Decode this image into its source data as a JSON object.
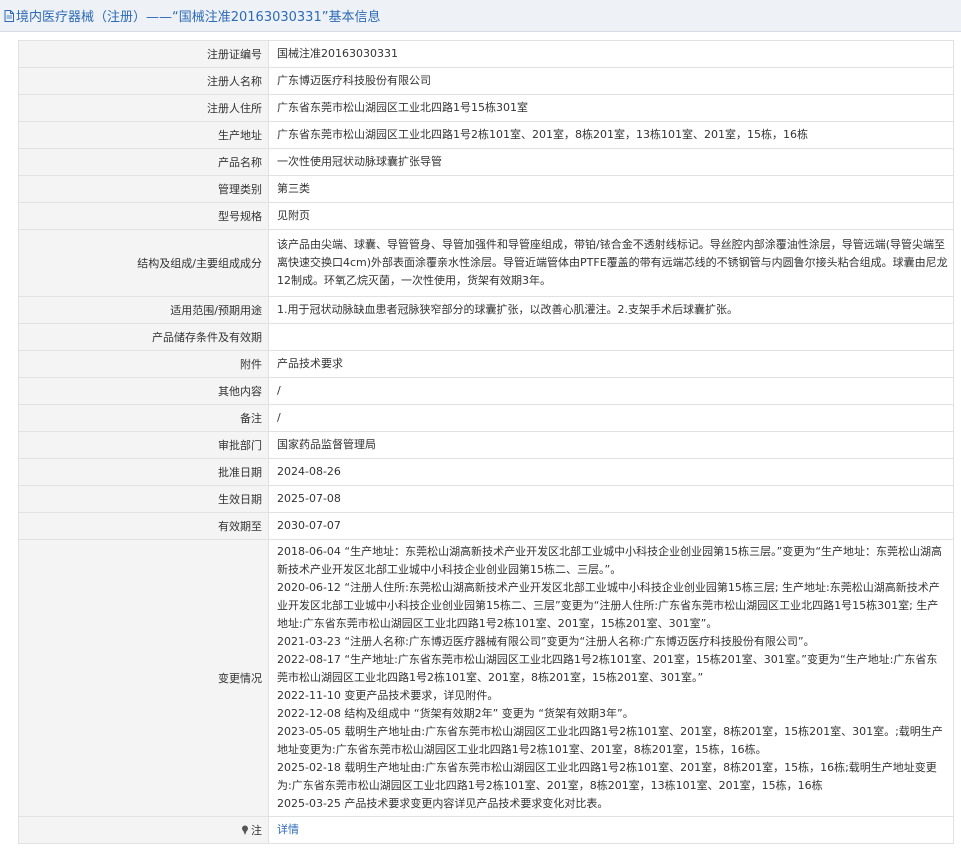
{
  "header": {
    "title": "境内医疗器械（注册）——“国械注准20163030331”基本信息"
  },
  "rows": [
    {
      "label": "注册证编号",
      "value": "国械注准20163030331"
    },
    {
      "label": "注册人名称",
      "value": "广东博迈医疗科技股份有限公司"
    },
    {
      "label": "注册人住所",
      "value": "广东省东莞市松山湖园区工业北四路1号15栋301室"
    },
    {
      "label": "生产地址",
      "value": "广东省东莞市松山湖园区工业北四路1号2栋101室、201室，8栋201室，13栋101室、201室，15栋，16栋"
    },
    {
      "label": "产品名称",
      "value": "一次性使用冠状动脉球囊扩张导管"
    },
    {
      "label": "管理类别",
      "value": "第三类"
    },
    {
      "label": "型号规格",
      "value": "见附页"
    },
    {
      "label": "结构及组成/主要组成成分",
      "value": "该产品由尖端、球囊、导管管身、导管加强件和导管座组成，带铂/铱合金不透射线标记。导丝腔内部涂覆油性涂层，导管远端(导管尖端至离快速交换口4cm)外部表面涂覆亲水性涂层。导管近端管体由PTFE覆盖的带有远端芯线的不锈钢管与内圆鲁尔接头粘合组成。球囊由尼龙12制成。环氧乙烷灭菌，一次性使用，货架有效期3年。"
    },
    {
      "label": "适用范围/预期用途",
      "value": "1.用于冠状动脉缺血患者冠脉狭窄部分的球囊扩张，以改善心肌灌注。2.支架手术后球囊扩张。"
    },
    {
      "label": "产品储存条件及有效期",
      "value": ""
    },
    {
      "label": "附件",
      "value": "产品技术要求"
    },
    {
      "label": "其他内容",
      "value": "/"
    },
    {
      "label": "备注",
      "value": "/"
    },
    {
      "label": "审批部门",
      "value": "国家药品监督管理局"
    },
    {
      "label": "批准日期",
      "value": "2024-08-26"
    },
    {
      "label": "生效日期",
      "value": "2025-07-08"
    },
    {
      "label": "有效期至",
      "value": "2030-07-07"
    }
  ],
  "changes": {
    "label": "变更情况",
    "items": [
      "2018-06-04 “生产地址：东莞松山湖高新技术产业开发区北部工业城中小科技企业创业园第15栋三层。”变更为“生产地址：东莞松山湖高新技术产业开发区北部工业城中小科技企业创业园第15栋二、三层。”。",
      "2020-06-12 “注册人住所:东莞松山湖高新技术产业开发区北部工业城中小科技企业创业园第15栋三层; 生产地址:东莞松山湖高新技术产业开发区北部工业城中小科技企业创业园第15栋二、三层”变更为“注册人住所:广东省东莞市松山湖园区工业北四路1号15栋301室; 生产地址:广东省东莞市松山湖园区工业北四路1号2栋101室、201室，15栋201室、301室”。",
      "2021-03-23 “注册人名称:广东博迈医疗器械有限公司”变更为“注册人名称:广东博迈医疗科技股份有限公司”。",
      "2022-08-17 “生产地址:广东省东莞市松山湖园区工业北四路1号2栋101室、201室，15栋201室、301室。”变更为“生产地址:广东省东莞市松山湖园区工业北四路1号2栋101室、201室，8栋201室，15栋201室、301室。”",
      "2022-11-10 变更产品技术要求，详见附件。",
      "2022-12-08 结构及组成中 “货架有效期2年” 变更为 “货架有效期3年”。",
      "2023-05-05 载明生产地址由:广东省东莞市松山湖园区工业北四路1号2栋101室、201室，8栋201室，15栋201室、301室。;载明生产地址变更为:广东省东莞市松山湖园区工业北四路1号2栋101室、201室，8栋201室，15栋，16栋。",
      "2025-02-18 载明生产地址由:广东省东莞市松山湖园区工业北四路1号2栋101室、201室，8栋201室，15栋，16栋;载明生产地址变更为:广东省东莞市松山湖园区工业北四路1号2栋101室、201室，8栋201室，13栋101室、201室，15栋，16栋",
      "2025-03-25 产品技术要求变更内容详见产品技术要求变化对比表。"
    ]
  },
  "note": {
    "label": "注",
    "link_text": "详情"
  },
  "icons": {
    "title": "document-icon",
    "note": "pin-icon"
  },
  "colors": {
    "link": "#2d6bb8",
    "label_bg": "#f4f4f4",
    "border": "#e1e1e1"
  }
}
